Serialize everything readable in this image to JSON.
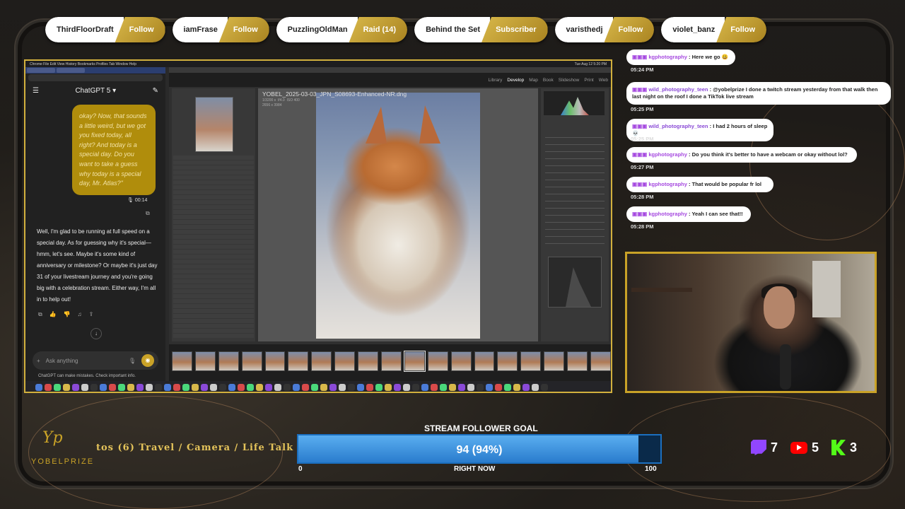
{
  "alerts": [
    {
      "name": "ThirdFloorDraft",
      "event": "Follow"
    },
    {
      "name": "iamFrase",
      "event": "Follow"
    },
    {
      "name": "PuzzlingOldMan",
      "event": "Raid (14)"
    },
    {
      "name": "Behind the Set",
      "event": "Subscriber"
    },
    {
      "name": "varisthedj",
      "event": "Follow"
    },
    {
      "name": "violet_banz",
      "event": "Follow"
    }
  ],
  "chatgpt": {
    "model": "ChatGPT 5",
    "user_bubble": "okay? Now, that sounds a little weird, but we got you fixed today, all right? And today is a special day. Do you want to take a guess why today is a special day, Mr. Atlas?\"",
    "duration": "00:14",
    "reply": "Well, I'm glad to be running at full speed on a special day. As for guessing why it's special—hmm, let's see. Maybe it's some kind of anniversary or milestone? Or maybe it's just day 31 of your livestream journey and you're going big with a celebration stream. Either way, I'm all in to help out!",
    "placeholder": "Ask anything",
    "disclaimer": "ChatGPT can make mistakes. Check important info."
  },
  "mac": {
    "menu": "Chrome  File  Edit  View  History  Bookmarks  Profiles  Tab  Window  Help",
    "clock": "Tue Aug 12  5:20 PM"
  },
  "lightroom": {
    "modules": [
      "Library",
      "Develop",
      "Map",
      "Book",
      "Slideshow",
      "Print",
      "Web"
    ],
    "active_module": "Develop",
    "filename": "YOBEL_2025-03-03_JPN_S08693-Enhanced-NR.dng",
    "meta": "1/3200 s  f/4.0  ISO 400\n2656 x 3984",
    "filmstrip_count": 19
  },
  "chat": [
    {
      "user": "kgphotography",
      "text": "Here we go 😃",
      "time": "05:24 PM",
      "color": "#a64ae0"
    },
    {
      "user": "wild_photography_teen",
      "text": "@yobelprize I done a twitch stream yesterday from that walk then last night on the roof I done a TikTok live stream",
      "time": "05:25 PM",
      "color": "#8a4ad6"
    },
    {
      "user": "wild_photography_teen",
      "text": "I had 2 hours of sleep 💀",
      "time": "05:25 PM",
      "color": "#8a4ad6"
    },
    {
      "user": "kgphotography",
      "text": "Do you think it's better to have a webcam or okay without lol?",
      "time": "05:27 PM",
      "color": "#a64ae0"
    },
    {
      "user": "kgphotography",
      "text": "That would be popular fr lol",
      "time": "05:28 PM",
      "color": "#a64ae0"
    },
    {
      "user": "kgphotography",
      "text": "Yeah I can see that!!",
      "time": "05:28 PM",
      "color": "#a64ae0"
    }
  ],
  "brand": {
    "logo": "Yp",
    "name": "YOBELPRIZE"
  },
  "ticker": "tos (6) Travel / Camera / Life Talk",
  "goal": {
    "title": "STREAM FOLLOWER GOAL",
    "current": 94,
    "target": 100,
    "label": "94 (94%)",
    "start": "0",
    "end": "100",
    "sub": "RIGHT NOW"
  },
  "stats": {
    "twitch": "7",
    "youtube": "5",
    "kick": "3"
  },
  "colors": {
    "accent": "#c9a227",
    "goal_bar": "#2a7ccd"
  }
}
